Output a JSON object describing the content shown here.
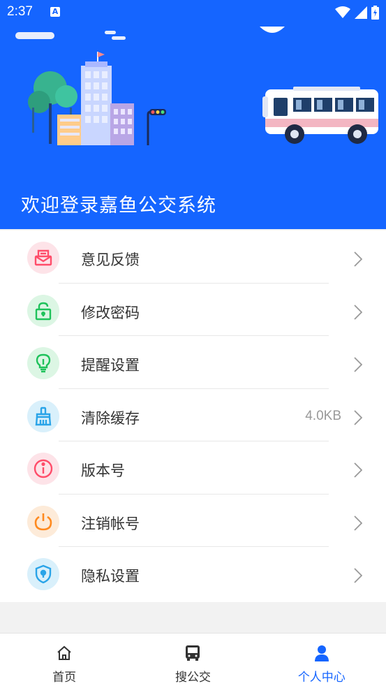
{
  "status_bar": {
    "time": "2:37",
    "notification_letter": "A"
  },
  "header": {
    "welcome_text": "欢迎登录嘉鱼公交系统"
  },
  "menu": [
    {
      "label": "意见反馈",
      "icon": "feedback-mail-icon",
      "color": "#ff4d6a",
      "bg": "#fde3e8",
      "value": ""
    },
    {
      "label": "修改密码",
      "icon": "unlock-icon",
      "color": "#1fc25b",
      "bg": "#dcf6e4",
      "value": ""
    },
    {
      "label": "提醒设置",
      "icon": "lightbulb-icon",
      "color": "#1fc25b",
      "bg": "#dcf6e4",
      "value": ""
    },
    {
      "label": "清除缓存",
      "icon": "broom-icon",
      "color": "#2aa4e8",
      "bg": "#d9f0fb",
      "value": "4.0KB"
    },
    {
      "label": "版本号",
      "icon": "info-icon",
      "color": "#ff4d6a",
      "bg": "#fde3e8",
      "value": ""
    },
    {
      "label": "注销帐号",
      "icon": "power-icon",
      "color": "#ff8a1f",
      "bg": "#fdebd9",
      "value": ""
    },
    {
      "label": "隐私设置",
      "icon": "shield-lock-icon",
      "color": "#2aa4e8",
      "bg": "#d9f0fb",
      "value": ""
    }
  ],
  "bottom_nav": [
    {
      "label": "首页",
      "icon": "home-icon",
      "active": false
    },
    {
      "label": "搜公交",
      "icon": "bus-icon",
      "active": false
    },
    {
      "label": "个人中心",
      "icon": "person-icon",
      "active": true
    }
  ],
  "colors": {
    "primary": "#1565ff",
    "text": "#333333",
    "muted": "#999999"
  }
}
